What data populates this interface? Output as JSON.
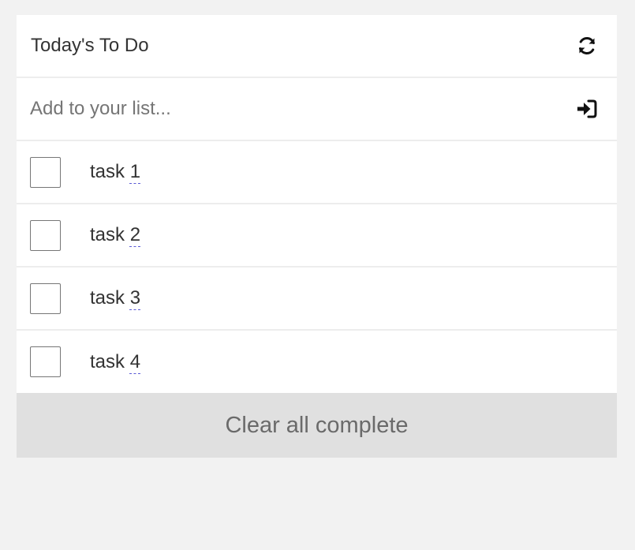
{
  "header": {
    "title": "Today's To Do",
    "refresh_icon": "refresh-icon"
  },
  "add": {
    "placeholder": "Add to your list...",
    "value": "",
    "submit_icon": "sign-in-icon"
  },
  "tasks": [
    {
      "prefix": "task ",
      "number": "1",
      "completed": false
    },
    {
      "prefix": "task ",
      "number": "2",
      "completed": false
    },
    {
      "prefix": "task ",
      "number": "3",
      "completed": false
    },
    {
      "prefix": "task ",
      "number": "4",
      "completed": false
    }
  ],
  "footer": {
    "clear_label": "Clear all complete"
  },
  "colors": {
    "background": "#f2f2f2",
    "card": "#ffffff",
    "divider": "#ededed",
    "button": "#e0e0e0",
    "button_text": "#6a6a6a",
    "text": "#333333",
    "spell_underline": "#5b5bd6"
  }
}
